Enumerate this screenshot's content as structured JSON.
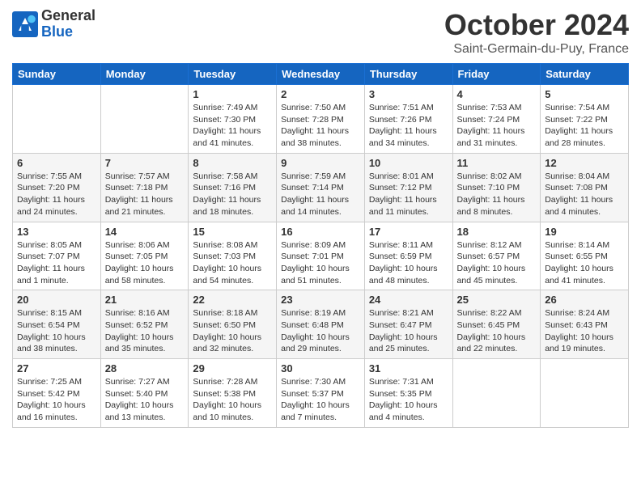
{
  "header": {
    "logo_general": "General",
    "logo_blue": "Blue",
    "month_title": "October 2024",
    "location": "Saint-Germain-du-Puy, France"
  },
  "days_of_week": [
    "Sunday",
    "Monday",
    "Tuesday",
    "Wednesday",
    "Thursday",
    "Friday",
    "Saturday"
  ],
  "weeks": [
    [
      {
        "day": "",
        "sunrise": "",
        "sunset": "",
        "daylight": ""
      },
      {
        "day": "",
        "sunrise": "",
        "sunset": "",
        "daylight": ""
      },
      {
        "day": "1",
        "sunrise": "Sunrise: 7:49 AM",
        "sunset": "Sunset: 7:30 PM",
        "daylight": "Daylight: 11 hours and 41 minutes."
      },
      {
        "day": "2",
        "sunrise": "Sunrise: 7:50 AM",
        "sunset": "Sunset: 7:28 PM",
        "daylight": "Daylight: 11 hours and 38 minutes."
      },
      {
        "day": "3",
        "sunrise": "Sunrise: 7:51 AM",
        "sunset": "Sunset: 7:26 PM",
        "daylight": "Daylight: 11 hours and 34 minutes."
      },
      {
        "day": "4",
        "sunrise": "Sunrise: 7:53 AM",
        "sunset": "Sunset: 7:24 PM",
        "daylight": "Daylight: 11 hours and 31 minutes."
      },
      {
        "day": "5",
        "sunrise": "Sunrise: 7:54 AM",
        "sunset": "Sunset: 7:22 PM",
        "daylight": "Daylight: 11 hours and 28 minutes."
      }
    ],
    [
      {
        "day": "6",
        "sunrise": "Sunrise: 7:55 AM",
        "sunset": "Sunset: 7:20 PM",
        "daylight": "Daylight: 11 hours and 24 minutes."
      },
      {
        "day": "7",
        "sunrise": "Sunrise: 7:57 AM",
        "sunset": "Sunset: 7:18 PM",
        "daylight": "Daylight: 11 hours and 21 minutes."
      },
      {
        "day": "8",
        "sunrise": "Sunrise: 7:58 AM",
        "sunset": "Sunset: 7:16 PM",
        "daylight": "Daylight: 11 hours and 18 minutes."
      },
      {
        "day": "9",
        "sunrise": "Sunrise: 7:59 AM",
        "sunset": "Sunset: 7:14 PM",
        "daylight": "Daylight: 11 hours and 14 minutes."
      },
      {
        "day": "10",
        "sunrise": "Sunrise: 8:01 AM",
        "sunset": "Sunset: 7:12 PM",
        "daylight": "Daylight: 11 hours and 11 minutes."
      },
      {
        "day": "11",
        "sunrise": "Sunrise: 8:02 AM",
        "sunset": "Sunset: 7:10 PM",
        "daylight": "Daylight: 11 hours and 8 minutes."
      },
      {
        "day": "12",
        "sunrise": "Sunrise: 8:04 AM",
        "sunset": "Sunset: 7:08 PM",
        "daylight": "Daylight: 11 hours and 4 minutes."
      }
    ],
    [
      {
        "day": "13",
        "sunrise": "Sunrise: 8:05 AM",
        "sunset": "Sunset: 7:07 PM",
        "daylight": "Daylight: 11 hours and 1 minute."
      },
      {
        "day": "14",
        "sunrise": "Sunrise: 8:06 AM",
        "sunset": "Sunset: 7:05 PM",
        "daylight": "Daylight: 10 hours and 58 minutes."
      },
      {
        "day": "15",
        "sunrise": "Sunrise: 8:08 AM",
        "sunset": "Sunset: 7:03 PM",
        "daylight": "Daylight: 10 hours and 54 minutes."
      },
      {
        "day": "16",
        "sunrise": "Sunrise: 8:09 AM",
        "sunset": "Sunset: 7:01 PM",
        "daylight": "Daylight: 10 hours and 51 minutes."
      },
      {
        "day": "17",
        "sunrise": "Sunrise: 8:11 AM",
        "sunset": "Sunset: 6:59 PM",
        "daylight": "Daylight: 10 hours and 48 minutes."
      },
      {
        "day": "18",
        "sunrise": "Sunrise: 8:12 AM",
        "sunset": "Sunset: 6:57 PM",
        "daylight": "Daylight: 10 hours and 45 minutes."
      },
      {
        "day": "19",
        "sunrise": "Sunrise: 8:14 AM",
        "sunset": "Sunset: 6:55 PM",
        "daylight": "Daylight: 10 hours and 41 minutes."
      }
    ],
    [
      {
        "day": "20",
        "sunrise": "Sunrise: 8:15 AM",
        "sunset": "Sunset: 6:54 PM",
        "daylight": "Daylight: 10 hours and 38 minutes."
      },
      {
        "day": "21",
        "sunrise": "Sunrise: 8:16 AM",
        "sunset": "Sunset: 6:52 PM",
        "daylight": "Daylight: 10 hours and 35 minutes."
      },
      {
        "day": "22",
        "sunrise": "Sunrise: 8:18 AM",
        "sunset": "Sunset: 6:50 PM",
        "daylight": "Daylight: 10 hours and 32 minutes."
      },
      {
        "day": "23",
        "sunrise": "Sunrise: 8:19 AM",
        "sunset": "Sunset: 6:48 PM",
        "daylight": "Daylight: 10 hours and 29 minutes."
      },
      {
        "day": "24",
        "sunrise": "Sunrise: 8:21 AM",
        "sunset": "Sunset: 6:47 PM",
        "daylight": "Daylight: 10 hours and 25 minutes."
      },
      {
        "day": "25",
        "sunrise": "Sunrise: 8:22 AM",
        "sunset": "Sunset: 6:45 PM",
        "daylight": "Daylight: 10 hours and 22 minutes."
      },
      {
        "day": "26",
        "sunrise": "Sunrise: 8:24 AM",
        "sunset": "Sunset: 6:43 PM",
        "daylight": "Daylight: 10 hours and 19 minutes."
      }
    ],
    [
      {
        "day": "27",
        "sunrise": "Sunrise: 7:25 AM",
        "sunset": "Sunset: 5:42 PM",
        "daylight": "Daylight: 10 hours and 16 minutes."
      },
      {
        "day": "28",
        "sunrise": "Sunrise: 7:27 AM",
        "sunset": "Sunset: 5:40 PM",
        "daylight": "Daylight: 10 hours and 13 minutes."
      },
      {
        "day": "29",
        "sunrise": "Sunrise: 7:28 AM",
        "sunset": "Sunset: 5:38 PM",
        "daylight": "Daylight: 10 hours and 10 minutes."
      },
      {
        "day": "30",
        "sunrise": "Sunrise: 7:30 AM",
        "sunset": "Sunset: 5:37 PM",
        "daylight": "Daylight: 10 hours and 7 minutes."
      },
      {
        "day": "31",
        "sunrise": "Sunrise: 7:31 AM",
        "sunset": "Sunset: 5:35 PM",
        "daylight": "Daylight: 10 hours and 4 minutes."
      },
      {
        "day": "",
        "sunrise": "",
        "sunset": "",
        "daylight": ""
      },
      {
        "day": "",
        "sunrise": "",
        "sunset": "",
        "daylight": ""
      }
    ]
  ]
}
